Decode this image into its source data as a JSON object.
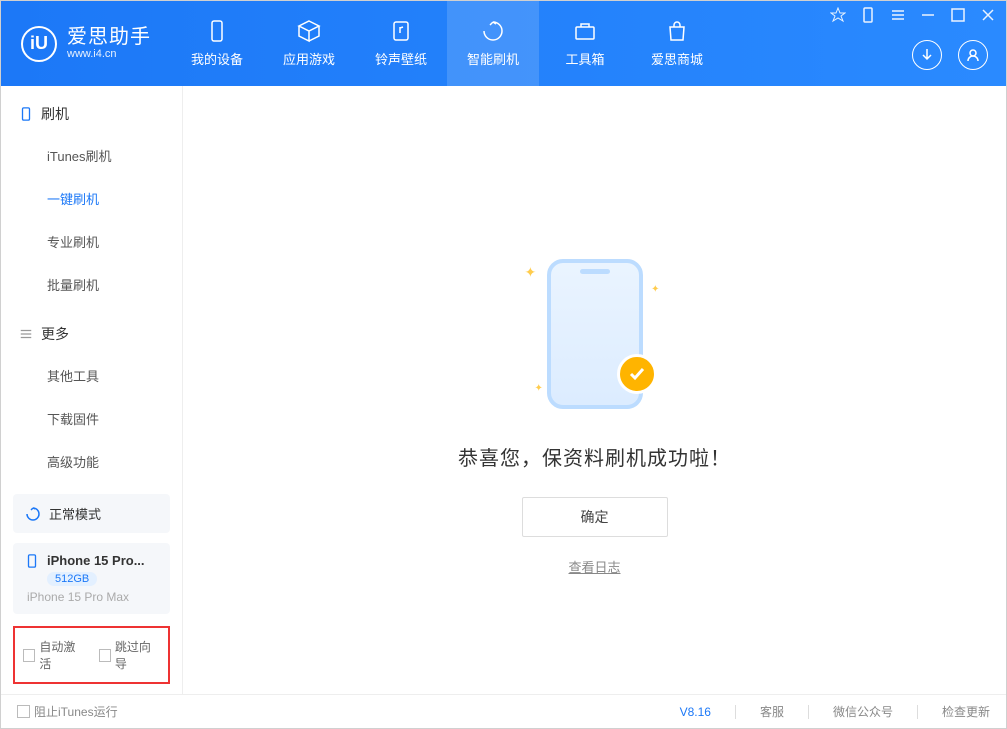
{
  "app": {
    "name": "爱思助手",
    "url": "www.i4.cn"
  },
  "nav": [
    {
      "label": "我的设备"
    },
    {
      "label": "应用游戏"
    },
    {
      "label": "铃声壁纸"
    },
    {
      "label": "智能刷机"
    },
    {
      "label": "工具箱"
    },
    {
      "label": "爱思商城"
    }
  ],
  "sidebar": {
    "section1": {
      "title": "刷机",
      "items": [
        "iTunes刷机",
        "一键刷机",
        "专业刷机",
        "批量刷机"
      ]
    },
    "section2": {
      "title": "更多",
      "items": [
        "其他工具",
        "下载固件",
        "高级功能"
      ]
    },
    "mode_label": "正常模式",
    "device": {
      "name": "iPhone 15 Pro...",
      "storage": "512GB",
      "model": "iPhone 15 Pro Max"
    },
    "opts": {
      "auto_activate": "自动激活",
      "skip_guide": "跳过向导"
    }
  },
  "main": {
    "success_text": "恭喜您，保资料刷机成功啦！",
    "confirm": "确定",
    "log_link": "查看日志"
  },
  "footer": {
    "block_itunes": "阻止iTunes运行",
    "version": "V8.16",
    "links": [
      "客服",
      "微信公众号",
      "检查更新"
    ]
  }
}
